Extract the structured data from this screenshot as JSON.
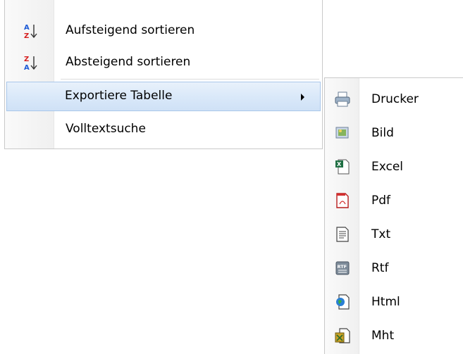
{
  "main_menu": {
    "items": [
      {
        "label": "Aufsteigend sortieren",
        "icon": "sort-ascending-icon"
      },
      {
        "label": "Absteigend sortieren",
        "icon": "sort-descending-icon"
      },
      {
        "label": "Exportiere Tabelle",
        "icon": "",
        "has_submenu": true,
        "highlighted": true
      },
      {
        "label": "Volltextsuche",
        "icon": ""
      }
    ]
  },
  "export_submenu": {
    "items": [
      {
        "label": "Drucker",
        "icon": "printer-icon"
      },
      {
        "label": "Bild",
        "icon": "image-icon"
      },
      {
        "label": "Excel",
        "icon": "excel-file-icon"
      },
      {
        "label": "Pdf",
        "icon": "pdf-file-icon"
      },
      {
        "label": "Txt",
        "icon": "text-file-icon"
      },
      {
        "label": "Rtf",
        "icon": "rtf-file-icon"
      },
      {
        "label": "Html",
        "icon": "html-file-icon"
      },
      {
        "label": "Mht",
        "icon": "mht-file-icon"
      }
    ]
  },
  "colors": {
    "highlight_top": "#e8f1fb",
    "highlight_bottom": "#cfe1f6",
    "highlight_border": "#a9c7ea",
    "gutter": "#f0f0f0",
    "menu_border": "#c9c9c9"
  }
}
